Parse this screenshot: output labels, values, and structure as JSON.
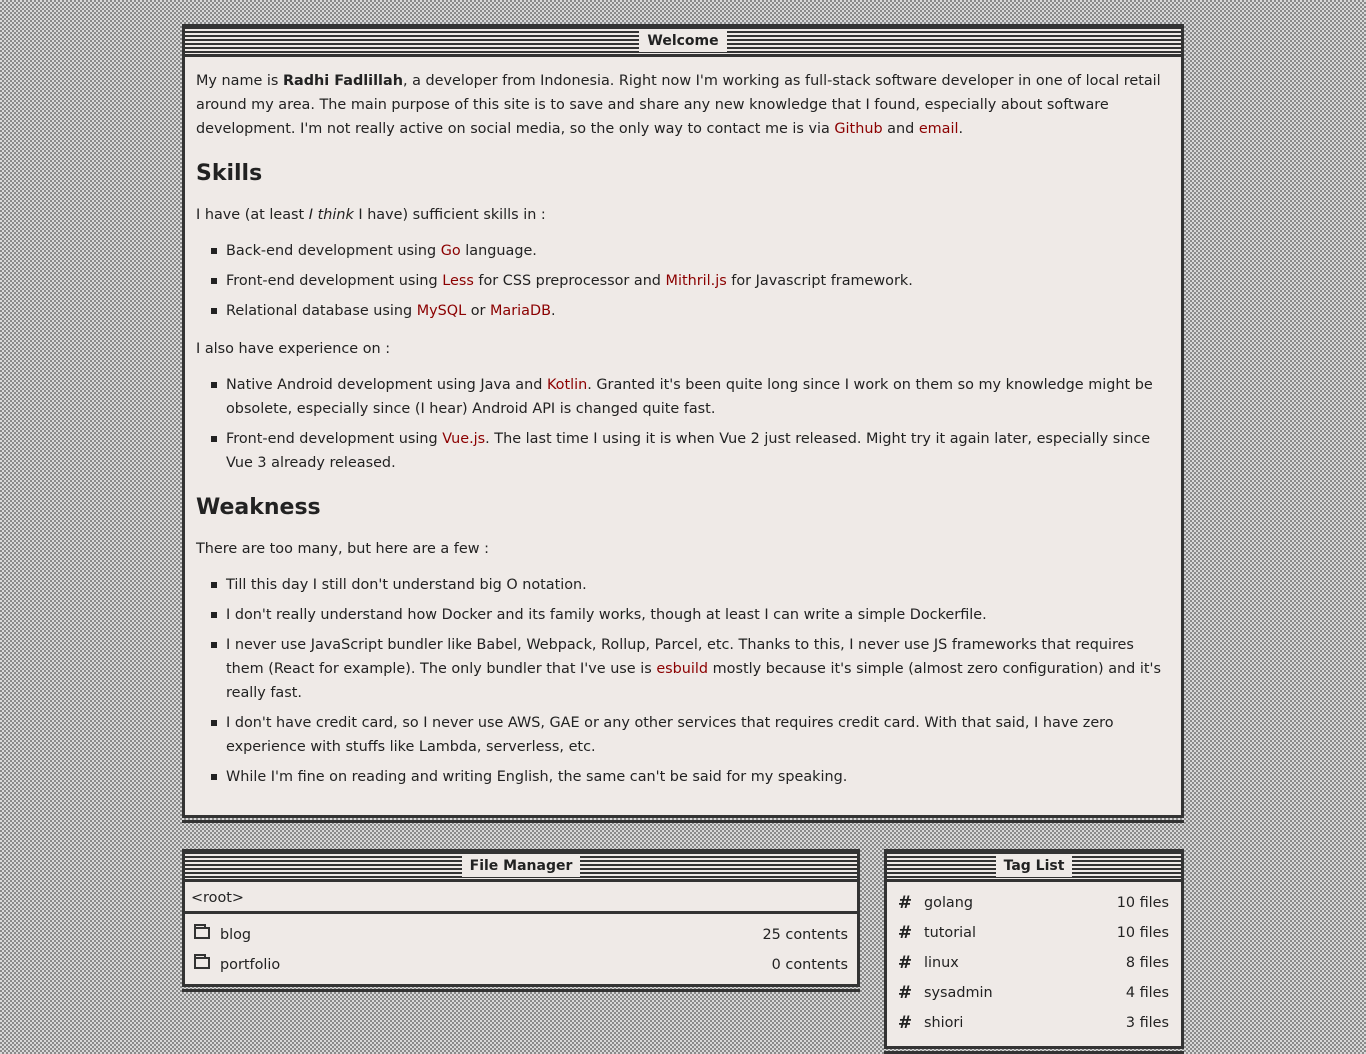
{
  "welcome": {
    "title": "Welcome",
    "intro": {
      "t1": "My name is ",
      "name": "Radhi Fadlillah",
      "t2": ", a developer from Indonesia. Right now I'm working as full-stack software developer in one of local retail around my area. The main purpose of this site is to save and share any new knowledge that I found, especially about software development. I'm not really active on social media, so the only way to contact me is via ",
      "github_link": "Github",
      "t3": " and ",
      "email_link": "email",
      "t4": "."
    },
    "skills": {
      "heading": "Skills",
      "intro_a": "I have (at least ",
      "intro_em": "I think",
      "intro_b": " I have) sufficient skills in :",
      "items": [
        {
          "a": "Back-end development using ",
          "link1": "Go",
          "b": " language."
        },
        {
          "a": "Front-end development using ",
          "link1": "Less",
          "b": " for CSS preprocessor and ",
          "link2": "Mithril.js",
          "c": " for Javascript framework."
        },
        {
          "a": "Relational database using ",
          "link1": "MySQL",
          "b": " or ",
          "link2": "MariaDB",
          "c": "."
        }
      ],
      "experience_intro": "I also have experience on :",
      "experience": [
        {
          "a": "Native Android development using Java and ",
          "link1": "Kotlin",
          "b": ". Granted it's been quite long since I work on them so my knowledge might be obsolete, especially since (I hear) Android API is changed quite fast."
        },
        {
          "a": "Front-end development using ",
          "link1": "Vue.js",
          "b": ". The last time I using it is when Vue 2 just released. Might try it again later, especially since Vue 3 already released."
        }
      ]
    },
    "weakness": {
      "heading": "Weakness",
      "intro": "There are too many, but here are a few :",
      "items": [
        {
          "a": "Till this day I still don't understand big O notation."
        },
        {
          "a": "I don't really understand how Docker and its family works, though at least I can write a simple Dockerfile."
        },
        {
          "a": "I never use JavaScript bundler like Babel, Webpack, Rollup, Parcel, etc. Thanks to this, I never use JS frameworks that requires them (React for example). The only bundler that I've use is ",
          "link1": "esbuild",
          "b": " mostly because it's simple (almost zero configuration) and it's really fast."
        },
        {
          "a": "I don't have credit card, so I never use AWS, GAE or any other services that requires credit card. With that said, I have zero experience with stuffs like Lambda, serverless, etc."
        },
        {
          "a": "While I'm fine on reading and writing English, the same can't be said for my speaking."
        }
      ]
    }
  },
  "file_manager": {
    "title": "File Manager",
    "path": "<root>",
    "items": [
      {
        "name": "blog",
        "count": "25 contents"
      },
      {
        "name": "portfolio",
        "count": "0 contents"
      }
    ]
  },
  "tag_list": {
    "title": "Tag List",
    "items": [
      {
        "name": "golang",
        "count": "10 files"
      },
      {
        "name": "tutorial",
        "count": "10 files"
      },
      {
        "name": "linux",
        "count": "8 files"
      },
      {
        "name": "sysadmin",
        "count": "4 files"
      },
      {
        "name": "shiori",
        "count": "3 files"
      }
    ]
  },
  "icons": {
    "folder": "folder-icon",
    "tag": "hash-icon",
    "bullet": "square-bullet"
  },
  "colors": {
    "link": "#8b0000",
    "window_bg": "#efeae7",
    "border": "#333333"
  }
}
